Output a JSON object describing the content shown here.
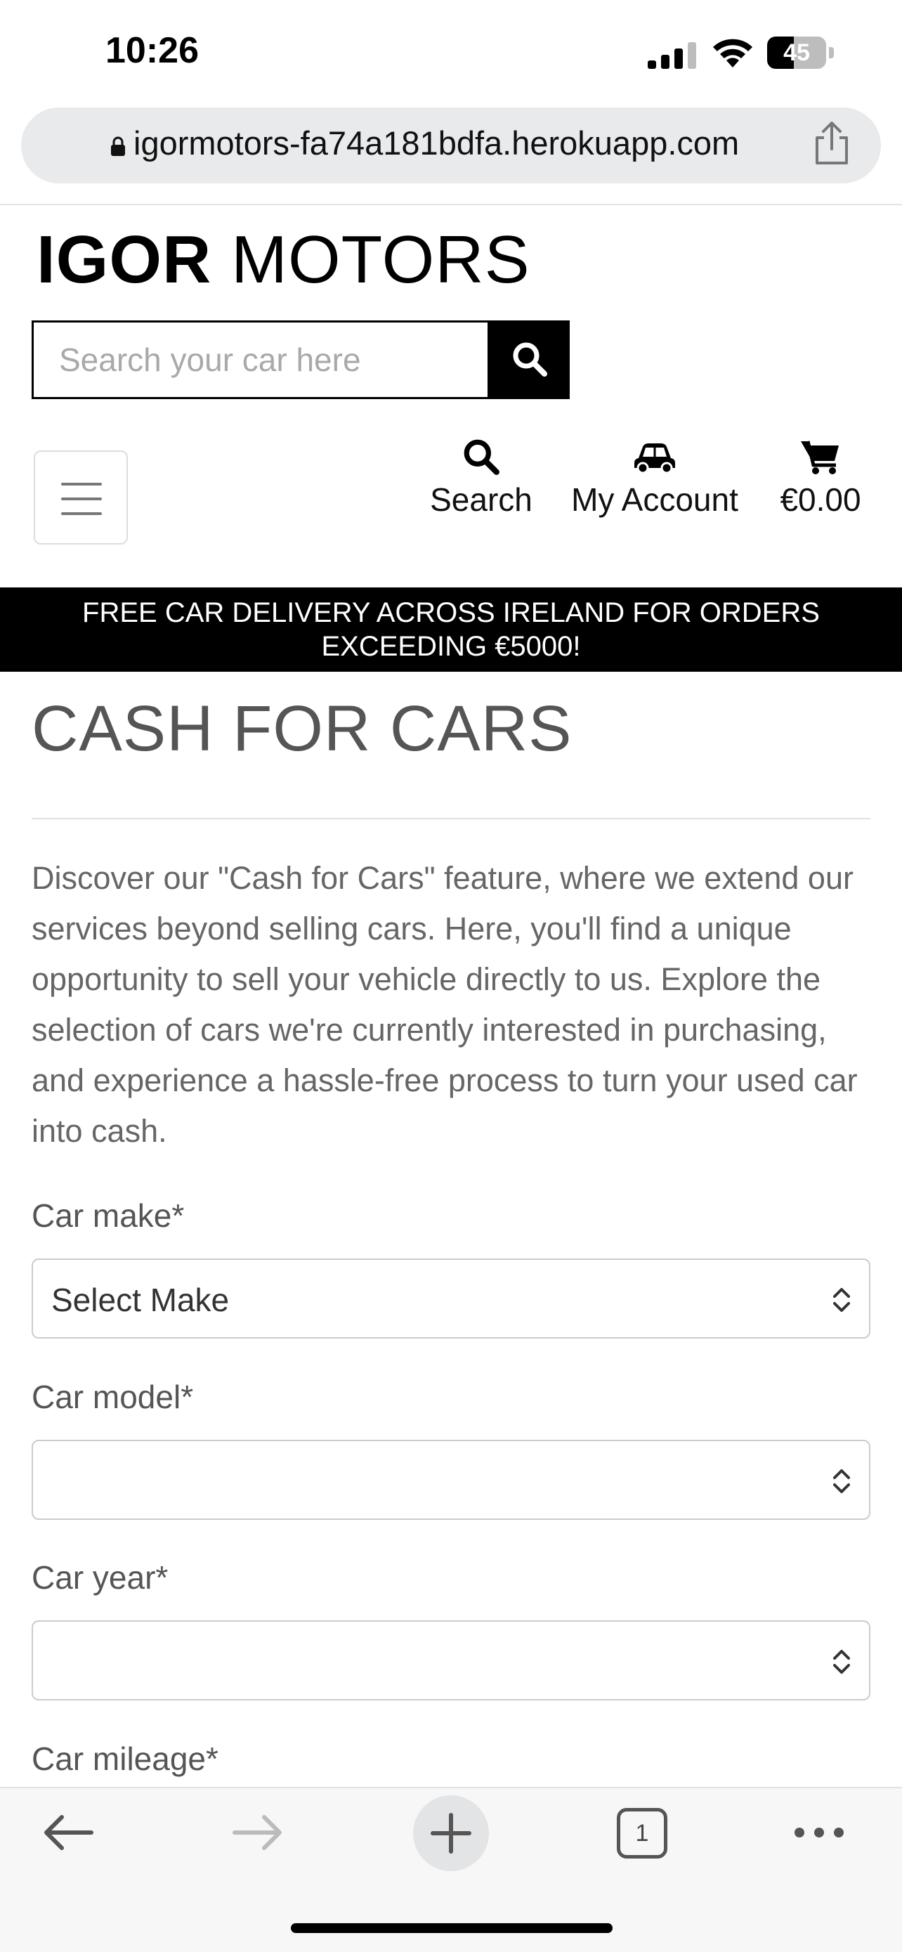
{
  "status_bar": {
    "time": "10:26",
    "battery_level": "45",
    "battery_fraction": 0.45
  },
  "browser": {
    "url": "igormotors-fa74a181bdfa.herokuapp.com"
  },
  "header": {
    "logo_bold": "IGOR",
    "logo_light": " MOTORS",
    "search_placeholder": "Search your car here",
    "nav": {
      "search_label": "Search",
      "account_label": "My Account",
      "cart_label": "€0.00"
    }
  },
  "banner": {
    "line1": "FREE CAR DELIVERY ACROSS IRELAND FOR ORDERS",
    "line2": "EXCEEDING €5000!"
  },
  "main": {
    "title": "CASH FOR CARS",
    "intro": "Discover our \"Cash for Cars\" feature, where we extend our services beyond selling cars. Here, you'll find a unique opportunity to sell your vehicle directly to us. Explore the selection of cars we're currently interested in purchasing, and experience a hassle-free process to turn your used car into cash.",
    "fields": {
      "make_label": "Car make*",
      "make_value": "Select Make",
      "model_label": "Car model*",
      "model_value": "",
      "year_label": "Car year*",
      "year_value": "",
      "mileage_label": "Car mileage*"
    }
  },
  "toolbar": {
    "tab_count": "1"
  }
}
